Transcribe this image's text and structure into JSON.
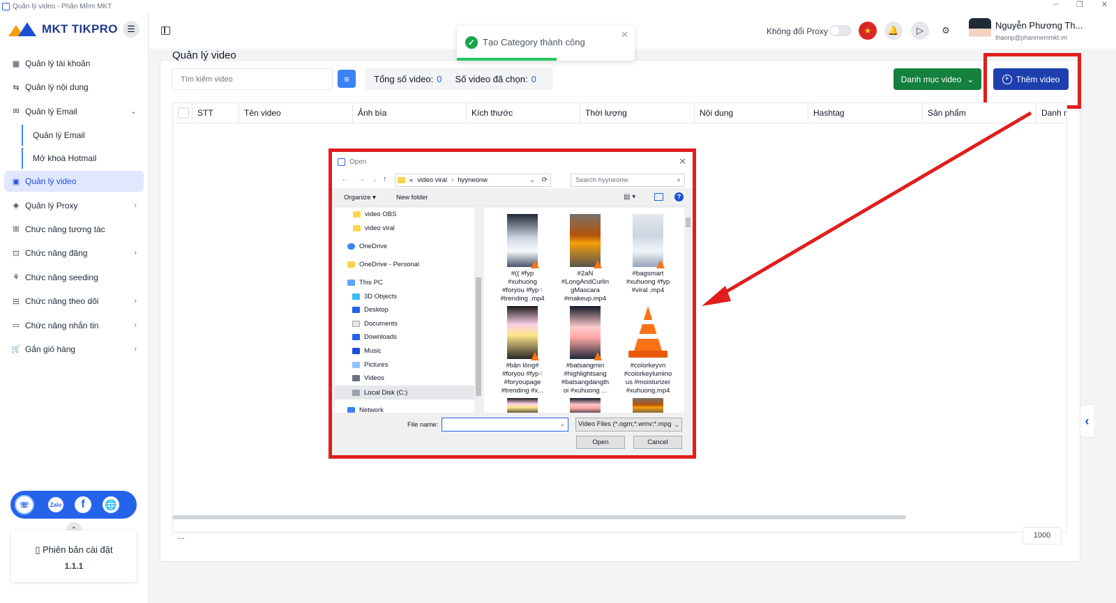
{
  "window": {
    "title": "Quản lý video - Phần Mềm MKT",
    "controls": [
      "–",
      "❐",
      "✕"
    ]
  },
  "sidebar": {
    "logo": "MKT TIKPRO",
    "items": [
      {
        "label": "Quản lý tài khoản",
        "icon": "grid-icon",
        "chevron": ""
      },
      {
        "label": "Quản lý nội dung",
        "icon": "content-icon",
        "chevron": ""
      },
      {
        "label": "Quản lý Email",
        "icon": "email-icon",
        "chevron": "⌄"
      },
      {
        "label": "Quản lý Email",
        "sub": true
      },
      {
        "label": "Mở khoá Hotmail",
        "sub": true
      },
      {
        "label": "Quản lý video",
        "icon": "video-icon",
        "chevron": "",
        "active": true
      },
      {
        "label": "Quản lý Proxy",
        "icon": "proxy-icon",
        "chevron": "›"
      },
      {
        "label": "Chức năng tương tác",
        "icon": "interact-icon",
        "chevron": ""
      },
      {
        "label": "Chức năng đăng",
        "icon": "post-icon",
        "chevron": "›"
      },
      {
        "label": "Chức năng seeding",
        "icon": "seeding-icon",
        "chevron": ""
      },
      {
        "label": "Chức năng theo dõi",
        "icon": "follow-icon",
        "chevron": "›"
      },
      {
        "label": "Chức năng nhắn tin",
        "icon": "message-icon",
        "chevron": "›"
      },
      {
        "label": "Gắn giỏ hàng",
        "icon": "cart-icon",
        "chevron": "›"
      }
    ],
    "social": {
      "zalo": "Zalo",
      "facebook": "f",
      "web": "🌐",
      "support": "☏"
    },
    "version_label": "Phiên bản cài đặt",
    "version_number": "1.1.1"
  },
  "header": {
    "proxy_label": "Không đổi Proxy",
    "user_name": "Nguyễn Phương Th...",
    "user_email": "thaonp@phanmemmkt.vn"
  },
  "toast": {
    "message": "Tạo Category thành công",
    "progress": 0.56
  },
  "main": {
    "title": "Quản lý video",
    "search_placeholder": "Tìm kiếm video",
    "total_label": "Tổng số video:",
    "total_value": "0",
    "selected_label": "Số video đã chọn:",
    "selected_value": "0",
    "category_button": "Danh mục video",
    "add_button": "Thêm video",
    "columns": [
      "STT",
      "Tên video",
      "Ảnh bìa",
      "Kích thước",
      "Thời lượng",
      "Nội dung",
      "Hashtag",
      "Sản phẩm",
      "Danh m"
    ],
    "pagination_dots": "...",
    "page_size": "1000"
  },
  "dialog": {
    "title": "Open",
    "address": [
      "«",
      "video viral",
      "›",
      "hyyneonw"
    ],
    "search_placeholder": "Search hyyneonw",
    "organize": "Organize ▾",
    "new_folder": "New folder",
    "tree": [
      {
        "label": "video OBS",
        "type": "folder"
      },
      {
        "label": "video viral",
        "type": "folder"
      },
      {
        "label": "OneDrive",
        "type": "cloud"
      },
      {
        "label": "OneDrive - Personal",
        "type": "folder"
      },
      {
        "label": "This PC",
        "type": "pc"
      },
      {
        "label": "3D Objects",
        "type": "obj"
      },
      {
        "label": "Desktop",
        "type": "desk"
      },
      {
        "label": "Documents",
        "type": "doc"
      },
      {
        "label": "Downloads",
        "type": "down"
      },
      {
        "label": "Music",
        "type": "music"
      },
      {
        "label": "Pictures",
        "type": "pic"
      },
      {
        "label": "Videos",
        "type": "vid"
      },
      {
        "label": "Local Disk (C:)",
        "type": "disk",
        "selected": true
      },
      {
        "label": "Network",
        "type": "net"
      }
    ],
    "files": [
      {
        "lines": [
          "#(( #fyp",
          "#xuhuong",
          "#foryou #fyp⁖",
          "#trending .mp4"
        ]
      },
      {
        "lines": [
          "#2aN",
          "#LongAndCurlin",
          "gMascara",
          "#makeup.mp4"
        ]
      },
      {
        "lines": [
          "#bagsmart",
          "#xuhuong #fyp",
          "#viral .mp4"
        ]
      },
      {
        "lines": [
          "#bận lòng#",
          "#foryou #fyp⁖",
          "#foryoupage",
          "#trending #x..."
        ]
      },
      {
        "lines": [
          "#batsangmin",
          "#highlightsang",
          "#batsangdangth",
          "oi #xuhuong ..."
        ]
      },
      {
        "lines": [
          "#colorkeyvn",
          "#colorkeylumino",
          "us #moisturizer",
          "#xuhuong.mp4"
        ]
      }
    ],
    "file_name_label": "File name:",
    "file_type": "Video Files (*.ogm;*.wmv;*.mpg",
    "open_button": "Open",
    "cancel_button": "Cancel"
  },
  "colors": {
    "accent": "#1e40af",
    "success": "#16a34a",
    "highlight": "#e11d1d",
    "category": "#15803d"
  }
}
